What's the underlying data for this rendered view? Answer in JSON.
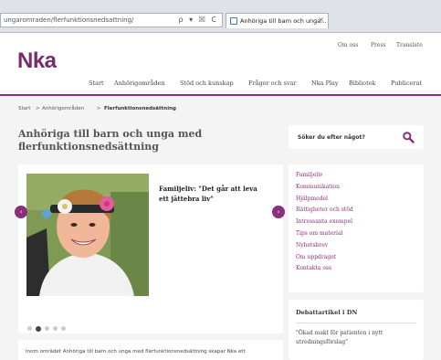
{
  "browser": {
    "url": "ungaromraden/flerfunktionsnedsattning/",
    "url_icons": "ρ ▾ ☒ C",
    "tab_title": "Anhöriga till barn och unga...",
    "tab_close": "×"
  },
  "header": {
    "logo": "Nka",
    "utility_links": [
      "Om oss",
      "Press",
      "Translate"
    ],
    "nav": [
      "Start",
      "Anhörigområden",
      "Stöd och kunskap",
      "Frågor och svar",
      "Nka Play",
      "Bibliotek",
      "Publicerat"
    ],
    "accent_color": "#8a2f7c"
  },
  "breadcrumb": {
    "start": "Start",
    "sep": ">",
    "area": "Anhörigområden",
    "current": "Flerfunktionsnedsättning"
  },
  "page": {
    "title": "Anhöriga till barn och unga med flerfunktionsnedsättning"
  },
  "search": {
    "label": "Söker du efter något?",
    "icon": "search-icon"
  },
  "slider": {
    "heading": "Familjeliv: \"Det går att leva ett jättebra liv\"",
    "prev": "‹",
    "next": "›",
    "slide_count": 5,
    "active_index": 1
  },
  "intro": {
    "text": "Inom området Anhöriga till barn och unga med flerfunktionsnedsättning skapar Nka ett"
  },
  "side_links": [
    "Familjeliv",
    "Kommunikation",
    "Hjälpmedel",
    "Rättigheter och stöd",
    "Intressanta exempel",
    "Tips om material",
    "Nyhetsbrev",
    "Om uppdraget",
    "Kontakta oss"
  ],
  "debate": {
    "heading": "Debattartikel i DN",
    "quote": "\"Ökad makt för patienten i nytt utredningsförslag\""
  }
}
